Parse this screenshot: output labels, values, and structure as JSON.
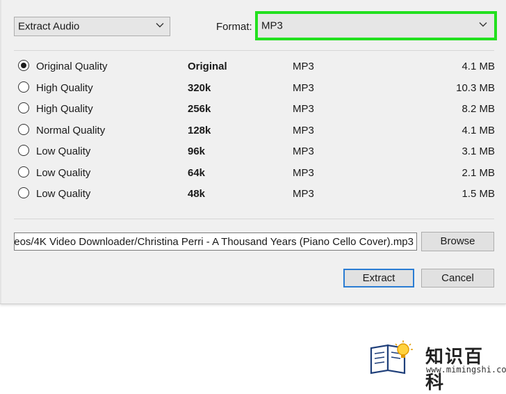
{
  "mode_dropdown": {
    "value": "Extract Audio"
  },
  "format": {
    "label": "Format:",
    "value": "MP3",
    "highlight_color": "#22e01e"
  },
  "quality_options": [
    {
      "label": "Original Quality",
      "bitrate": "Original",
      "format": "MP3",
      "size": "4.1 MB",
      "selected": true
    },
    {
      "label": "High Quality",
      "bitrate": "320k",
      "format": "MP3",
      "size": "10.3 MB",
      "selected": false
    },
    {
      "label": "High Quality",
      "bitrate": "256k",
      "format": "MP3",
      "size": "8.2 MB",
      "selected": false
    },
    {
      "label": "Normal Quality",
      "bitrate": "128k",
      "format": "MP3",
      "size": "4.1 MB",
      "selected": false
    },
    {
      "label": "Low Quality",
      "bitrate": "96k",
      "format": "MP3",
      "size": "3.1 MB",
      "selected": false
    },
    {
      "label": "Low Quality",
      "bitrate": "64k",
      "format": "MP3",
      "size": "2.1 MB",
      "selected": false
    },
    {
      "label": "Low Quality",
      "bitrate": "48k",
      "format": "MP3",
      "size": "1.5 MB",
      "selected": false
    }
  ],
  "output_path": {
    "value": "eos/4K Video Downloader/Christina Perri - A Thousand Years (Piano Cello Cover).mp3"
  },
  "buttons": {
    "browse": "Browse",
    "extract": "Extract",
    "cancel": "Cancel"
  },
  "watermark": {
    "name": "知识百科",
    "url": "www.mimingshi.com"
  }
}
